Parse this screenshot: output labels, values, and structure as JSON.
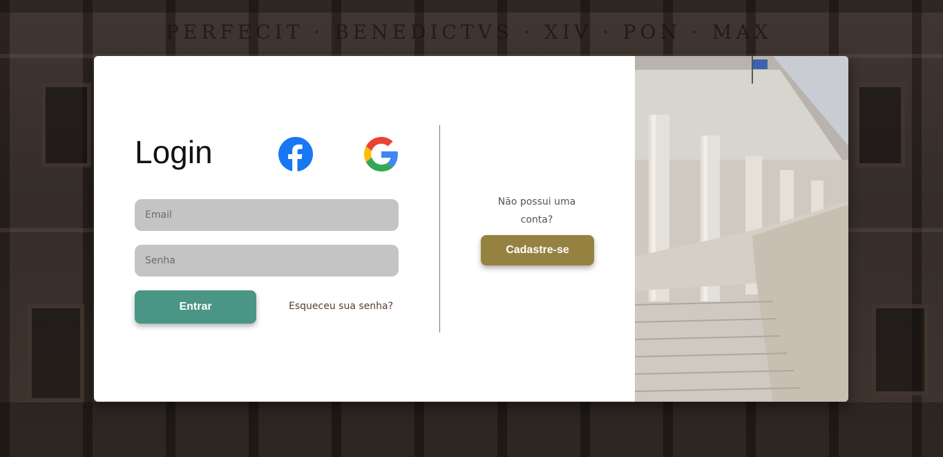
{
  "login": {
    "title": "Login",
    "email_placeholder": "Email",
    "password_placeholder": "Senha",
    "submit_label": "Entrar",
    "forgot_label": "Esqueceu sua senha?",
    "social": [
      {
        "icon": "facebook-icon",
        "color": "#1877f2"
      },
      {
        "icon": "google-icon",
        "colors": [
          "#4285f4",
          "#ea4335",
          "#fbbc05",
          "#34a853"
        ]
      }
    ]
  },
  "signup": {
    "prompt": "Não possui uma conta?",
    "button_label": "Cadastre-se"
  },
  "background": {
    "inscription": "PERFECIT · BENEDICTVS · XIV · PON · MAX"
  },
  "colors": {
    "enter_button": "#4a9585",
    "signup_button": "#968240",
    "input_bg": "#c4c4c4",
    "forgot_link": "#5b3a2e"
  }
}
